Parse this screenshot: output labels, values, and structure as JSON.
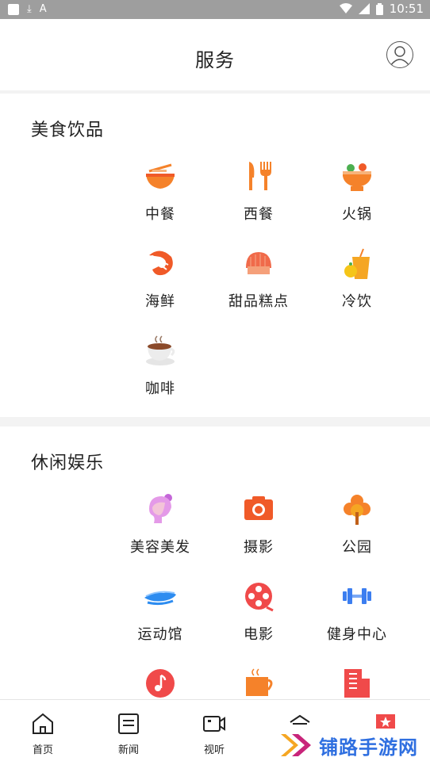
{
  "status_bar": {
    "time": "10:51",
    "glyph_download": "⤓",
    "glyph_a": "A"
  },
  "header": {
    "title": "服务"
  },
  "food_section": {
    "title": "美食饮品",
    "items": [
      {
        "label": "中餐",
        "icon": "noodle-bowl-icon"
      },
      {
        "label": "西餐",
        "icon": "fork-knife-icon"
      },
      {
        "label": "火锅",
        "icon": "hotpot-icon"
      },
      {
        "label": "海鲜",
        "icon": "shrimp-icon"
      },
      {
        "label": "甜品糕点",
        "icon": "cake-icon"
      },
      {
        "label": "冷饮",
        "icon": "juice-icon"
      },
      {
        "label": "咖啡",
        "icon": "coffee-cup-icon"
      }
    ]
  },
  "leisure_section": {
    "title": "休闲娱乐",
    "items": [
      {
        "label": "美容美发",
        "icon": "woman-hair-icon"
      },
      {
        "label": "摄影",
        "icon": "camera-icon"
      },
      {
        "label": "公园",
        "icon": "tree-icon"
      },
      {
        "label": "运动馆",
        "icon": "stadium-icon"
      },
      {
        "label": "电影",
        "icon": "film-reel-icon"
      },
      {
        "label": "健身中心",
        "icon": "dumbbell-icon"
      },
      {
        "label": "",
        "icon": "music-note-icon"
      },
      {
        "label": "",
        "icon": "coffee-mug-icon"
      },
      {
        "label": "",
        "icon": "building-icon"
      }
    ]
  },
  "tabbar": {
    "tabs": [
      {
        "label": "首页",
        "icon": "home-icon"
      },
      {
        "label": "新闻",
        "icon": "news-icon"
      },
      {
        "label": "视听",
        "icon": "video-icon"
      },
      {
        "label": "",
        "icon": "service-icon"
      },
      {
        "label": "",
        "icon": "star-icon"
      }
    ]
  },
  "watermark": {
    "text": "铺路手游网"
  },
  "colors": {
    "accent_orange": "#f5822a",
    "accent_red": "#f04a4a",
    "text": "#222222",
    "background": "#f3f3f3"
  }
}
